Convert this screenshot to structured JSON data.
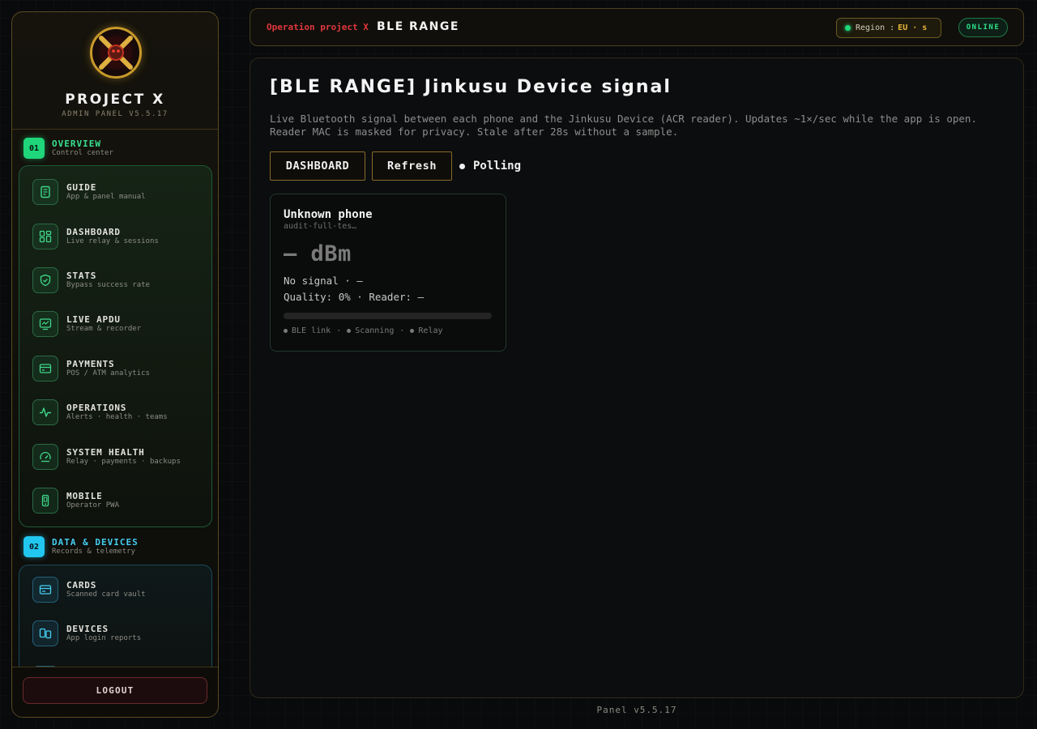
{
  "brand": {
    "title": "PROJECT X",
    "subtitle": "ADMIN PANEL V5.5.17"
  },
  "sections": [
    {
      "num": "01",
      "title": "OVERVIEW",
      "subtitle": "Control center",
      "color": "#38e08e",
      "items": [
        {
          "label": "GUIDE",
          "sub": "App & panel manual",
          "icon": "document-icon"
        },
        {
          "label": "DASHBOARD",
          "sub": "Live relay & sessions",
          "icon": "dashboard-icon"
        },
        {
          "label": "STATS",
          "sub": "Bypass success rate",
          "icon": "shield-icon"
        },
        {
          "label": "LIVE APDU",
          "sub": "Stream & recorder",
          "icon": "monitor-icon"
        },
        {
          "label": "PAYMENTS",
          "sub": "POS / ATM analytics",
          "icon": "payment-icon"
        },
        {
          "label": "OPERATIONS",
          "sub": "Alerts · health · teams",
          "icon": "pulse-icon"
        },
        {
          "label": "SYSTEM HEALTH",
          "sub": "Relay · payments · backups",
          "icon": "gauge-icon"
        },
        {
          "label": "MOBILE",
          "sub": "Operator PWA",
          "icon": "phone-icon"
        }
      ]
    },
    {
      "num": "02",
      "title": "DATA & DEVICES",
      "subtitle": "Records & telemetry",
      "color": "#45cdf0",
      "items": [
        {
          "label": "CARDS",
          "sub": "Scanned card vault",
          "icon": "card-icon"
        },
        {
          "label": "DEVICES",
          "sub": "App login reports",
          "icon": "devices-icon"
        }
      ]
    }
  ],
  "logout_label": "LOGOUT",
  "topbar": {
    "operation": "Operation project X",
    "page": "BLE RANGE",
    "region_label": "Region :",
    "region_value": "EU · s",
    "status": "ONLINE"
  },
  "main": {
    "title": "[BLE RANGE] Jinkusu Device signal",
    "description": "Live Bluetooth signal between each phone and the Jinkusu Device (ACR reader). Updates ~1×/sec while the app is open. Reader MAC is masked for privacy. Stale after 28s without a sample.",
    "buttons": {
      "dashboard": "DASHBOARD",
      "refresh": "Refresh"
    },
    "polling": "Polling"
  },
  "card": {
    "title": "Unknown phone",
    "subtitle": "audit-full-tes…",
    "dbm": "— dBm",
    "signal": "No signal · —",
    "quality": "Quality: 0% · Reader: —",
    "quality_fraction": 0,
    "statuses": [
      "BLE link",
      "Scanning",
      "Relay"
    ]
  },
  "version": "Panel v5.5.17"
}
